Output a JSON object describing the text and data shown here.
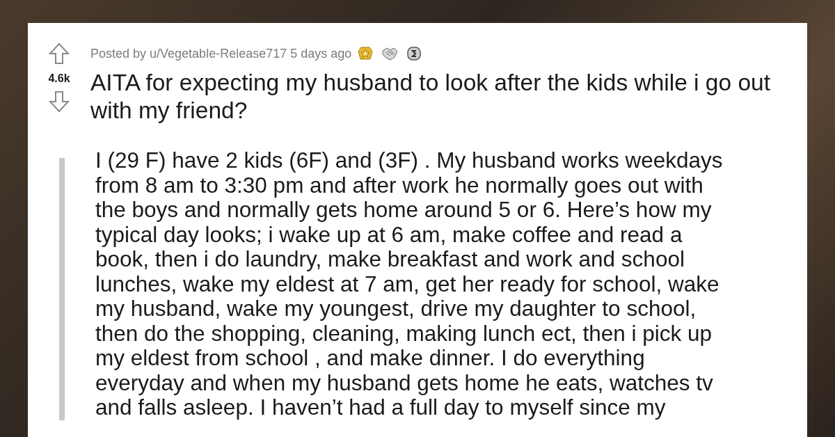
{
  "post": {
    "meta": "Posted by u/Vegetable-Release717 5 days ago",
    "awards": [
      {
        "kind": "star"
      },
      {
        "kind": "handshake"
      },
      {
        "kind": "coin"
      }
    ],
    "score": "4.6k",
    "title": "AITA for expecting my husband to look after the kids while i go out with my friend?",
    "body_lines": [
      "I (29 F) have 2 kids (6F) and (3F) . My husband works weekdays",
      "from 8 am to 3:30 pm and after work he normally goes out with",
      "the boys and normally gets home around 5 or 6. Here’s how my",
      "typical day looks; i wake up at 6 am, make coffee and read a",
      "book, then i do laundry, make breakfast and work and school",
      "lunches, wake my eldest at 7 am, get her ready for school, wake",
      "my husband, wake my youngest, drive my daughter to school,",
      "then do the shopping, cleaning, making lunch ect, then i pick up",
      "my eldest from school , and make dinner. I do everything",
      "everyday and when my husband gets home he eats, watches tv",
      "and falls asleep. I haven’t had a full day to myself since my"
    ]
  }
}
